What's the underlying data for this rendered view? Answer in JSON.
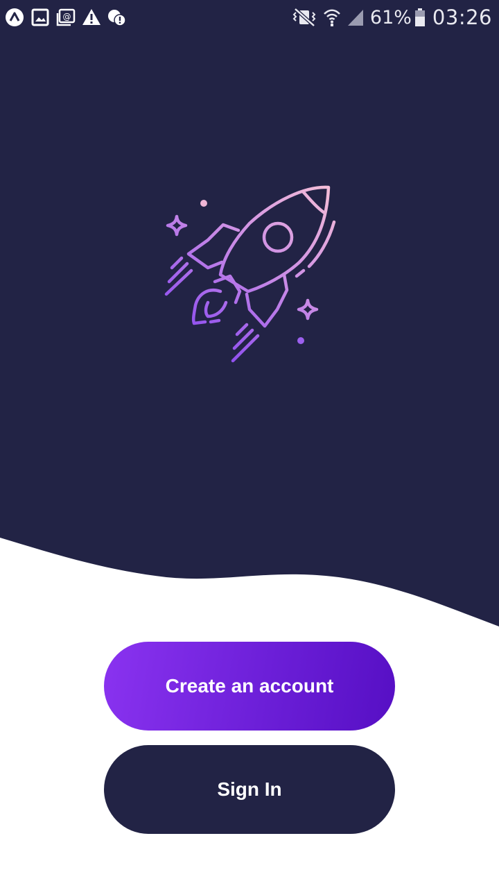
{
  "status_bar": {
    "left_icons": [
      "app-logo-icon",
      "image-icon",
      "mail-icon",
      "warning-icon",
      "chat-alert-icon"
    ],
    "right_icons": [
      "vibrate-icon",
      "wifi-icon",
      "signal-icon",
      "battery-icon"
    ],
    "battery_percent": "61%",
    "time": "03:26"
  },
  "hero": {
    "background_color": "#222345",
    "illustration": "rocket-launch-icon",
    "gradient_colors": [
      "#f0b8d8",
      "#8e4ef0"
    ]
  },
  "actions": {
    "create_account_label": "Create an account",
    "sign_in_label": "Sign In"
  },
  "colors": {
    "primary_gradient_start": "#8a33f0",
    "primary_gradient_end": "#560fc4",
    "secondary_button": "#222345"
  }
}
